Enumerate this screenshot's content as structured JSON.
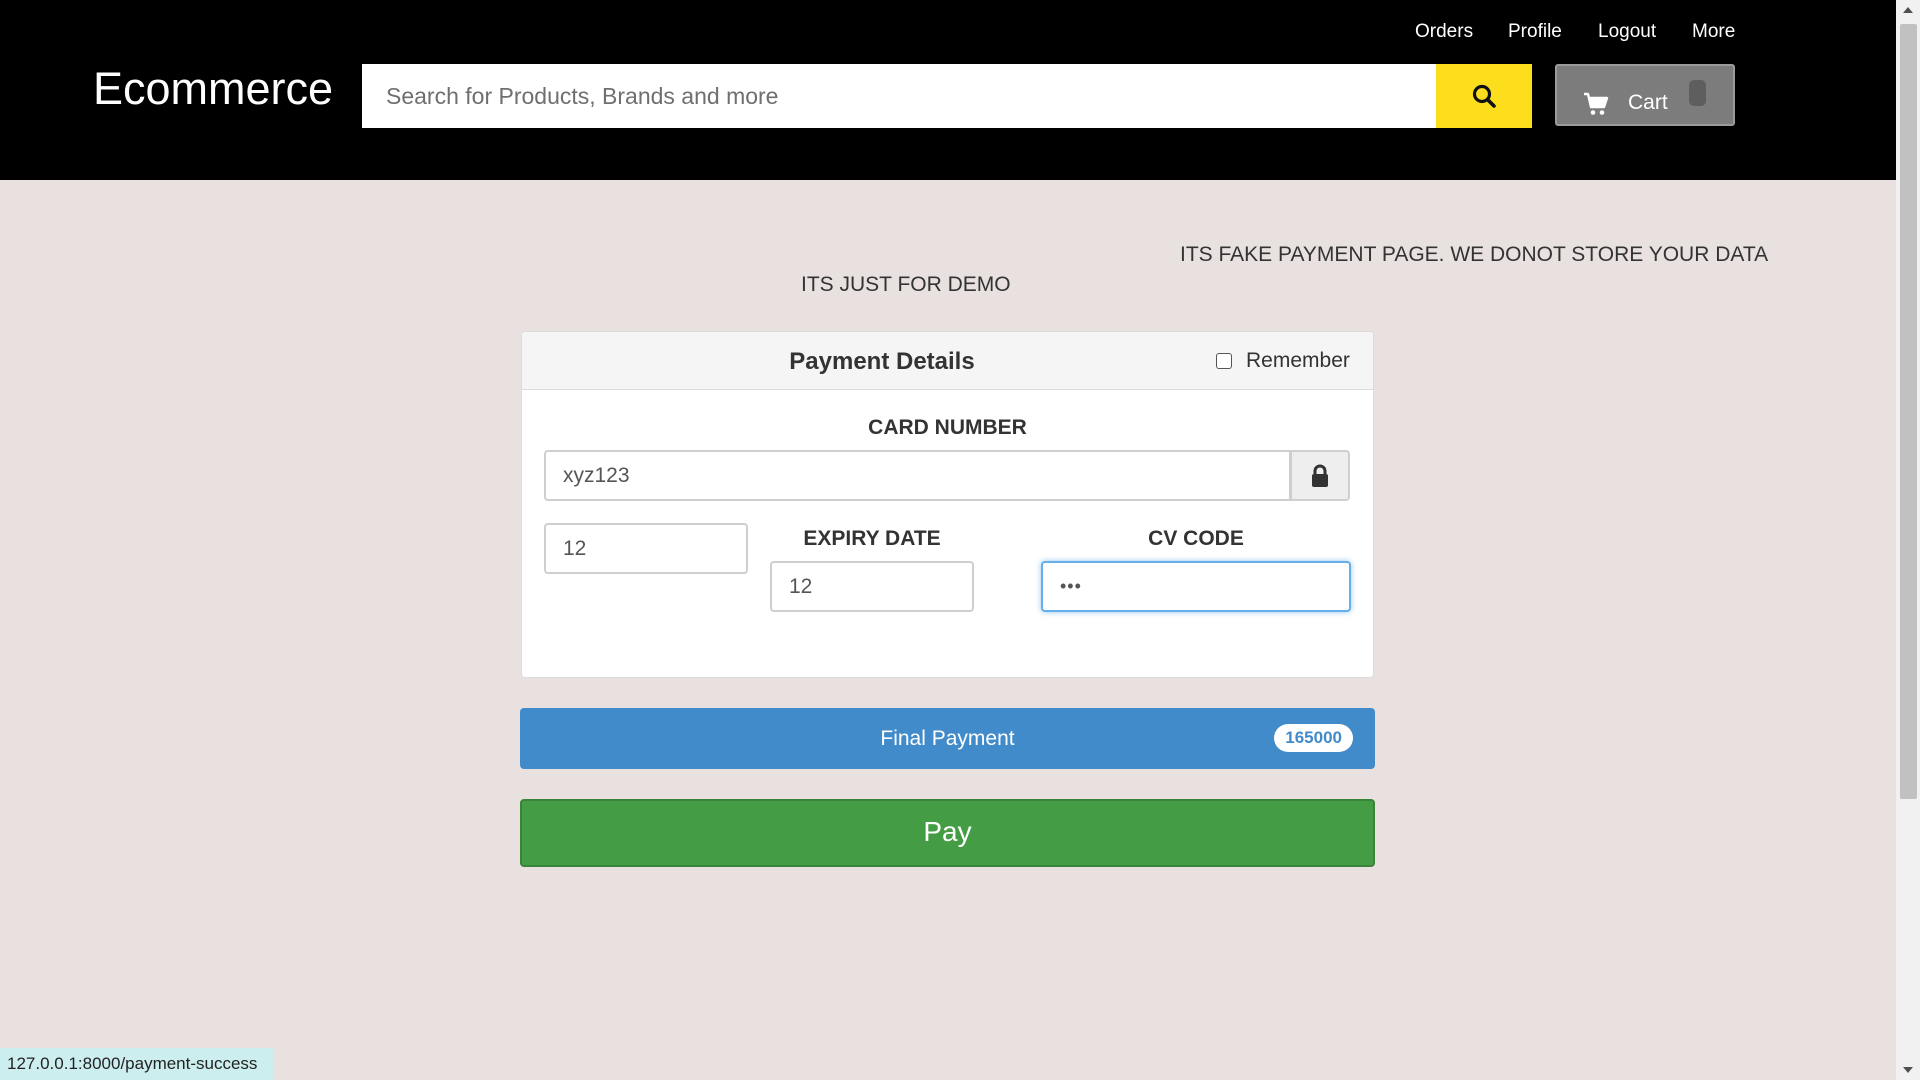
{
  "nav": {
    "links": [
      "Orders",
      "Profile",
      "Logout",
      "More"
    ]
  },
  "header": {
    "brand": "Ecommerce",
    "search_placeholder": "Search for Products, Brands and more",
    "search_icon": "search-icon",
    "cart_label": "Cart",
    "cart_icon": "cart-icon",
    "accent_color": "#fdde1c"
  },
  "notices": {
    "fake_notice": "ITS FAKE PAYMENT PAGE. WE DONOT STORE YOUR DATA",
    "demo_notice": "ITS JUST FOR DEMO"
  },
  "payment": {
    "title": "Payment Details",
    "remember_label": "Remember",
    "remember_checked": false,
    "card_number_label": "CARD NUMBER",
    "card_number_value": "xyz123",
    "lock_icon": "lock-icon",
    "expiry_label": "EXPIRY DATE",
    "expiry_month": "12",
    "expiry_year": "12",
    "cv_label": "CV CODE",
    "cv_value": "•••"
  },
  "final_payment": {
    "label": "Final Payment",
    "amount": "165000",
    "color": "#428bca"
  },
  "pay_button": {
    "label": "Pay",
    "color": "#449d44"
  },
  "status_bar": {
    "url": "127.0.0.1:8000/payment-success"
  }
}
